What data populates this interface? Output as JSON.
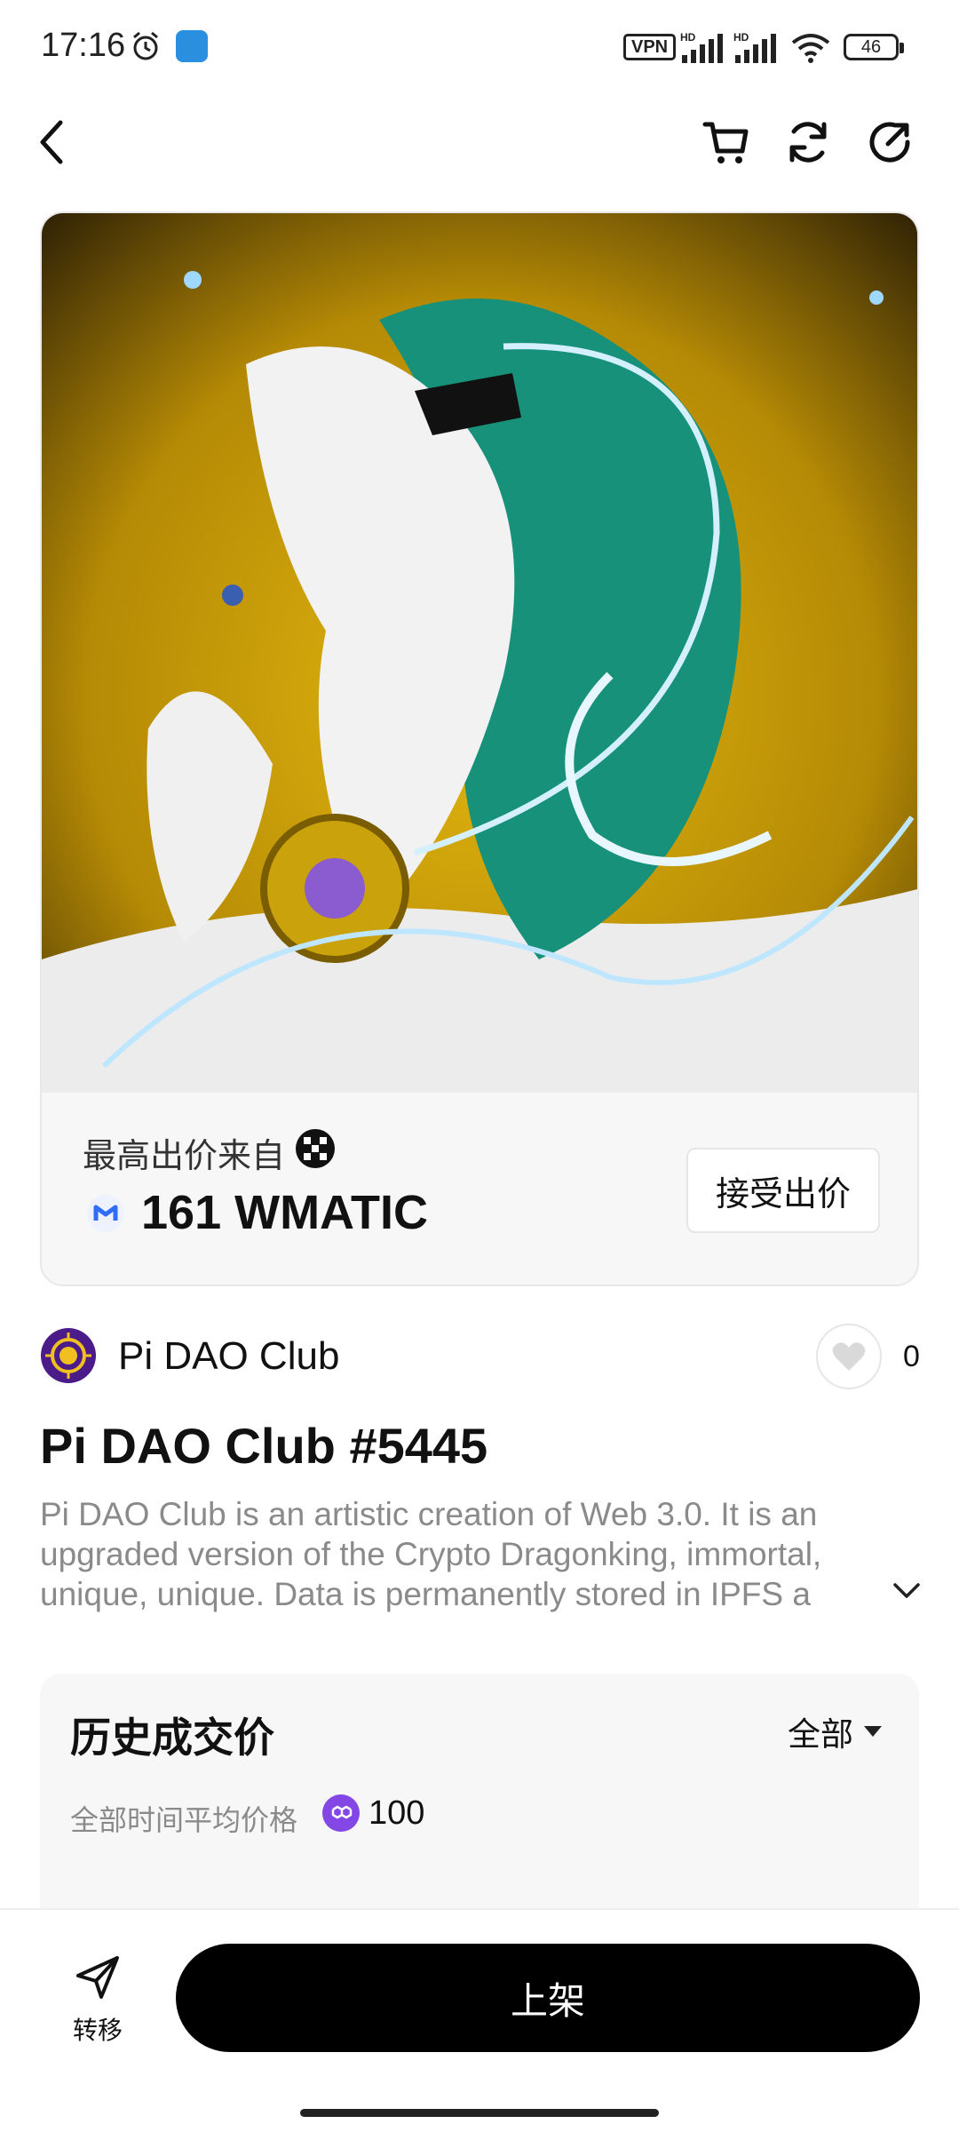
{
  "status_bar": {
    "time": "17:16",
    "vpn": "VPN",
    "battery": "46",
    "icons": [
      "alarm-icon",
      "app-notification-icon",
      "signal-icon",
      "signal-icon",
      "wifi-icon",
      "battery-icon"
    ]
  },
  "nav": {
    "icons": [
      "back-icon",
      "cart-icon",
      "refresh-icon",
      "share-icon"
    ]
  },
  "offer": {
    "label": "最高出价来自",
    "value": "161 WMATIC",
    "accept_label": "接受出价"
  },
  "collection": {
    "name": "Pi DAO Club",
    "like_count": "0"
  },
  "nft": {
    "title": "Pi DAO Club #5445",
    "description": "Pi DAO Club is an artistic creation of Web 3.0. It is an upgraded version of the Crypto Dragonking, immortal, unique, unique. Data is permanently stored in IPFS a"
  },
  "history": {
    "title": "历史成交价",
    "filter": "全部",
    "avg_label": "全部时间平均价格",
    "avg_value": "100"
  },
  "bottom": {
    "transfer_label": "转移",
    "list_label": "上架"
  },
  "colors": {
    "accent_purple": "#8247e5",
    "primary_button": "#000000",
    "card_bg": "#f7f7f7",
    "muted_text": "#8a8a8a"
  }
}
